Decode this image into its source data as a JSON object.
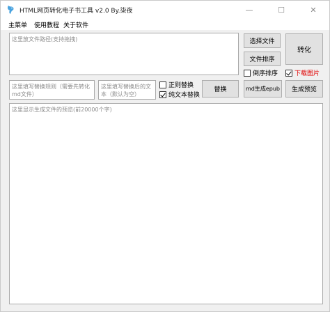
{
  "window": {
    "title": "HTML网页转化电子书工具 v2.0 By.柒夜",
    "controls": {
      "minimize": "—",
      "maximize": "☐",
      "close": "✕"
    }
  },
  "menu": [
    "主菜单",
    "使用教程",
    "关于软件"
  ],
  "inputs": {
    "file_path_placeholder": "这里放文件路径(支持拖拽)",
    "rule_placeholder": "这里填写替换规则（需要先转化\nmd文件）",
    "replace_with_placeholder": "这里填写替换后的文\n本（默认为空）",
    "preview_placeholder": "这里显示生成文件的预览(前20000个字)"
  },
  "buttons": {
    "select_file": "选择文件",
    "sort_files": "文件排序",
    "convert": "转化",
    "replace": "替换",
    "md_to_epub": "md生成epub",
    "preview": "生成预览"
  },
  "checkboxes": {
    "reverse_sort": {
      "label": "倒序排序",
      "checked": false
    },
    "download_images": {
      "label": "下载图片",
      "checked": true,
      "color": "#e00000"
    },
    "regex_replace": {
      "label": "正则替换",
      "checked": false
    },
    "plain_text_replace": {
      "label": "纯文本替换",
      "checked": true
    }
  },
  "icons": {
    "app": "app-bird-icon"
  }
}
